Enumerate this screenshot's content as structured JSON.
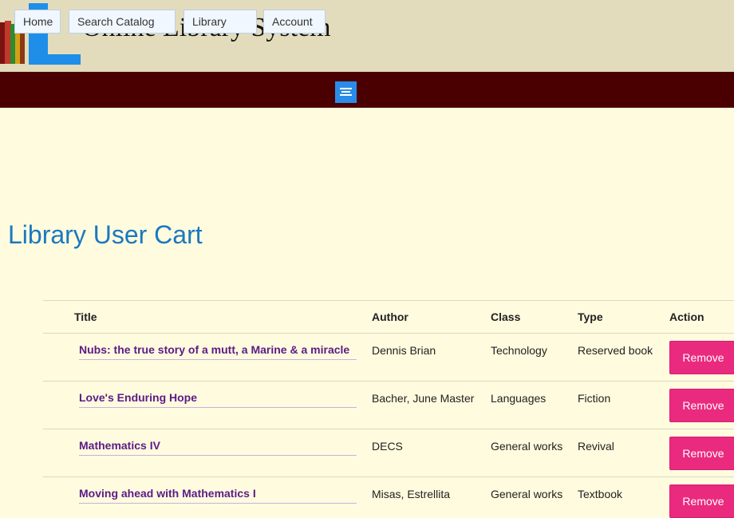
{
  "header": {
    "title": "Online Library System"
  },
  "nav": {
    "items": [
      {
        "label": "Home"
      },
      {
        "label": "Search Catalog"
      },
      {
        "label": "Library"
      },
      {
        "label": "Account"
      }
    ]
  },
  "page": {
    "title": "Library User Cart"
  },
  "table": {
    "headers": {
      "title": "Title",
      "author": "Author",
      "class": "Class",
      "type": "Type",
      "action": "Action"
    },
    "rows": [
      {
        "title": "Nubs: the true story of a mutt, a Marine & a miracle",
        "author": "Dennis Brian",
        "class": "Technology",
        "type": "Reserved book",
        "action": "Remove"
      },
      {
        "title": "Love's Enduring Hope",
        "author": "Bacher, June Master",
        "class": "Languages",
        "type": "Fiction",
        "action": "Remove"
      },
      {
        "title": "Mathematics IV",
        "author": "DECS",
        "class": "General works",
        "type": "Revival",
        "action": "Remove"
      },
      {
        "title": "Moving ahead with Mathematics I",
        "author": "Misas, Estrellita",
        "class": "General works",
        "type": "Textbook",
        "action": "Remove"
      }
    ]
  },
  "colors": {
    "navbar": "#4a0000",
    "header": "#e2dcbc",
    "background": "#fffbdf",
    "accent_title": "#1a78c0",
    "link": "#5c1b87",
    "remove_button": "#ea2a7f",
    "menu_button": "#2a8ce8"
  }
}
